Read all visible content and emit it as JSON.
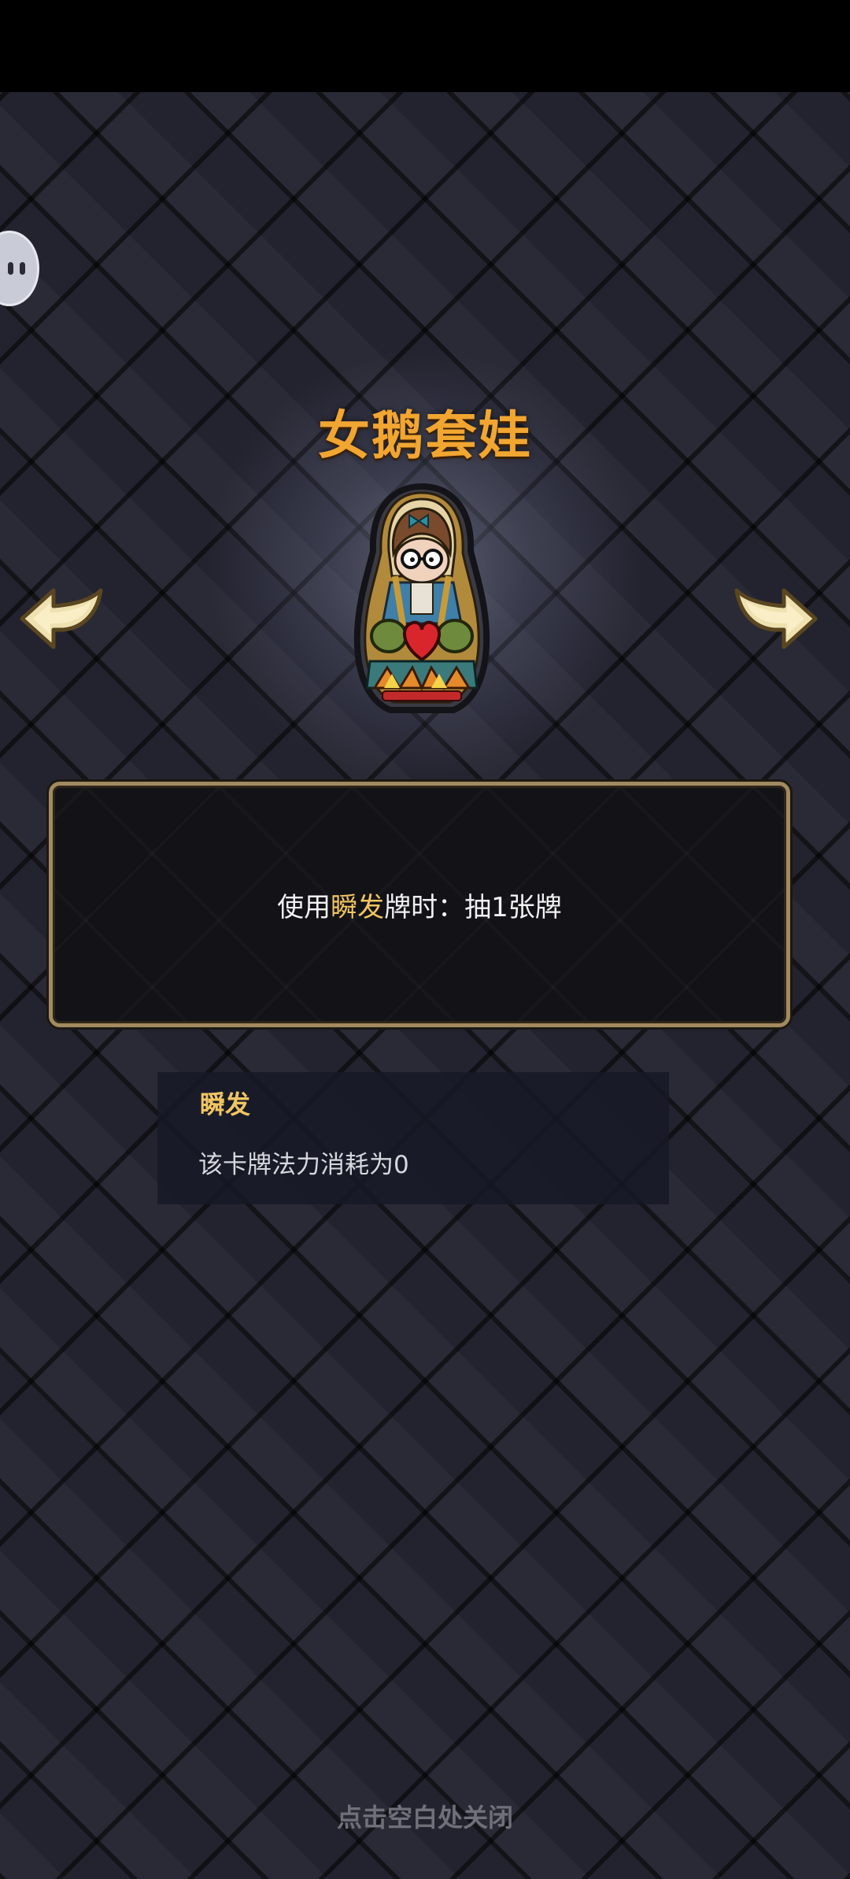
{
  "item": {
    "name": "女鹅套娃",
    "icon": "matryoshka-doll-icon"
  },
  "navigation": {
    "prev_icon": "arrow-left-icon",
    "next_icon": "arrow-right-icon"
  },
  "description": {
    "prefix": "使用",
    "keyword": "瞬发",
    "suffix": "牌时：抽1张牌"
  },
  "keyword_tooltip": {
    "title": "瞬发",
    "text": "该卡牌法力消耗为0"
  },
  "footer": {
    "close_hint": "点击空白处关闭"
  },
  "colors": {
    "title": "#f1a631",
    "keyword": "#f2c562",
    "panel_border": "#a28a60",
    "background": "#23232f"
  }
}
